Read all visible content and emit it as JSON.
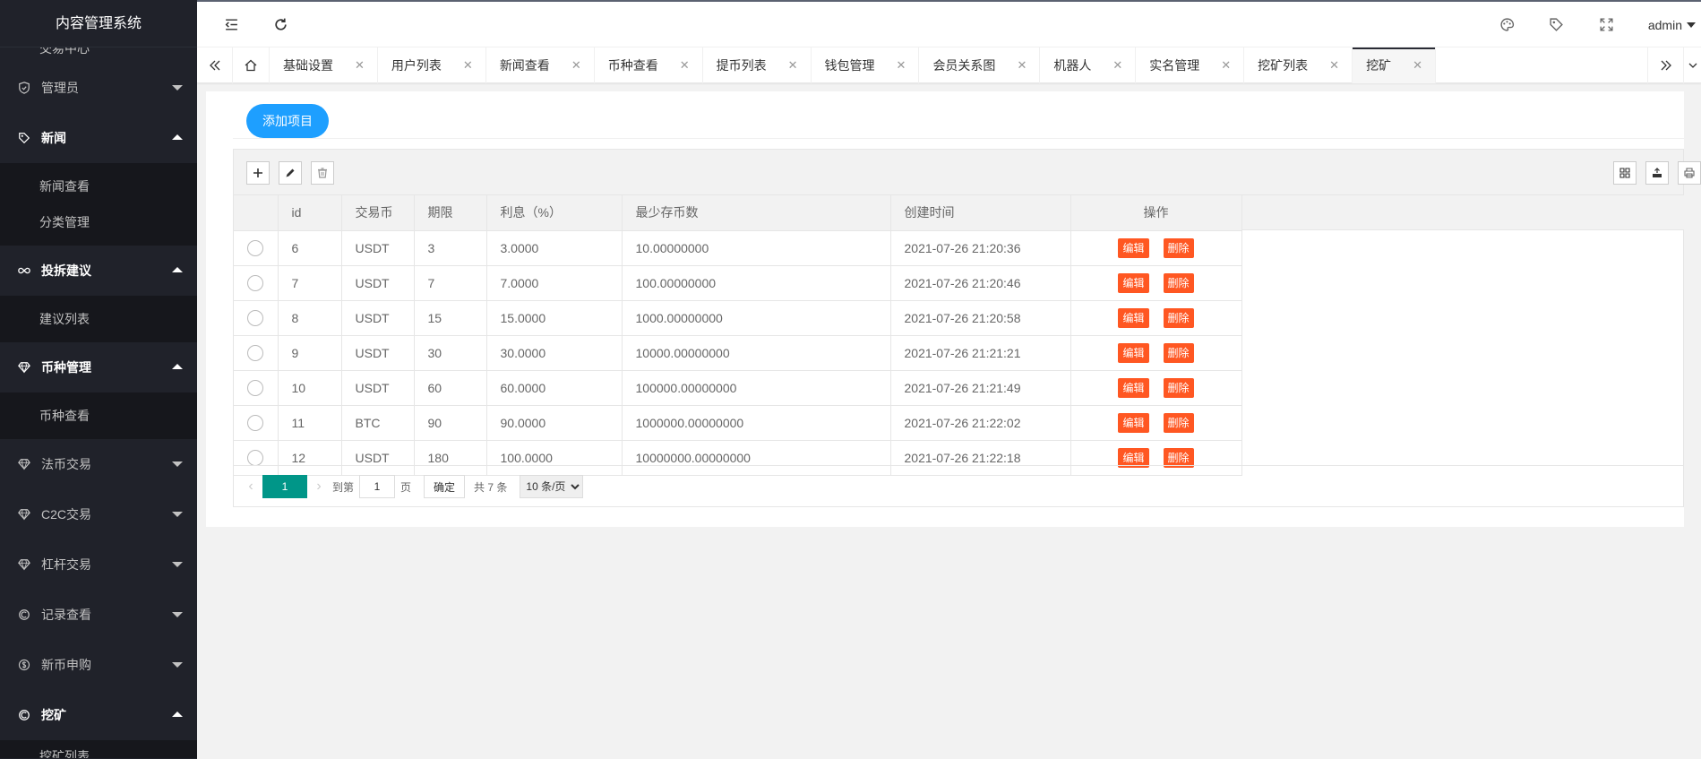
{
  "app_title": "内容管理系统",
  "sidebar": {
    "clipped_top": "交易中心",
    "items": [
      {
        "label": "管理员",
        "icon": "shield-icon",
        "open": false
      },
      {
        "label": "新闻",
        "icon": "tag-icon",
        "open": true,
        "children": [
          "新闻查看",
          "分类管理"
        ]
      },
      {
        "label": "投拆建议",
        "icon": "infinity-icon",
        "open": true,
        "children": [
          "建议列表"
        ]
      },
      {
        "label": "币种管理",
        "icon": "diamond-icon",
        "open": true,
        "children": [
          "币种查看"
        ]
      },
      {
        "label": "法币交易",
        "icon": "diamond-icon",
        "open": false
      },
      {
        "label": "C2C交易",
        "icon": "diamond-icon",
        "open": false
      },
      {
        "label": "杠杆交易",
        "icon": "diamond-icon",
        "open": false
      },
      {
        "label": "记录查看",
        "icon": "refresh-c-icon",
        "open": false
      },
      {
        "label": "新币申购",
        "icon": "dollar-icon",
        "open": false
      },
      {
        "label": "挖矿",
        "icon": "refresh-c-icon",
        "open": true,
        "children": [
          "挖矿列表"
        ]
      }
    ]
  },
  "header": {
    "user": "admin"
  },
  "tabs": [
    "基础设置",
    "用户列表",
    "新闻查看",
    "币种查看",
    "提币列表",
    "钱包管理",
    "会员关系图",
    "机器人",
    "实名管理",
    "挖矿列表",
    "挖矿"
  ],
  "active_tab": "挖矿",
  "add_button": "添加项目",
  "table": {
    "columns": [
      "id",
      "交易币",
      "期限",
      "利息（%）",
      "最少存币数",
      "创建时间",
      "操作"
    ],
    "rows": [
      [
        "6",
        "USDT",
        "3",
        "3.0000",
        "10.00000000",
        "2021-07-26 21:20:36"
      ],
      [
        "7",
        "USDT",
        "7",
        "7.0000",
        "100.00000000",
        "2021-07-26 21:20:46"
      ],
      [
        "8",
        "USDT",
        "15",
        "15.0000",
        "1000.00000000",
        "2021-07-26 21:20:58"
      ],
      [
        "9",
        "USDT",
        "30",
        "30.0000",
        "10000.00000000",
        "2021-07-26 21:21:21"
      ],
      [
        "10",
        "USDT",
        "60",
        "60.0000",
        "100000.00000000",
        "2021-07-26 21:21:49"
      ],
      [
        "11",
        "BTC",
        "90",
        "90.0000",
        "1000000.00000000",
        "2021-07-26 21:22:02"
      ],
      [
        "12",
        "USDT",
        "180",
        "100.0000",
        "10000000.00000000",
        "2021-07-26 21:22:18"
      ]
    ],
    "edit_label": "编辑",
    "delete_label": "删除"
  },
  "pager": {
    "current": "1",
    "goto_label": "到第",
    "goto_value": "1",
    "page_unit": "页",
    "confirm": "确定",
    "total": "共 7 条",
    "page_size": "10 条/页"
  },
  "colors": {
    "sidebar_bg": "#20222a",
    "submenu_bg": "#16171c",
    "primary_blue": "#1e9fff",
    "danger_orange": "#ff5722",
    "pager_green": "#009688"
  }
}
